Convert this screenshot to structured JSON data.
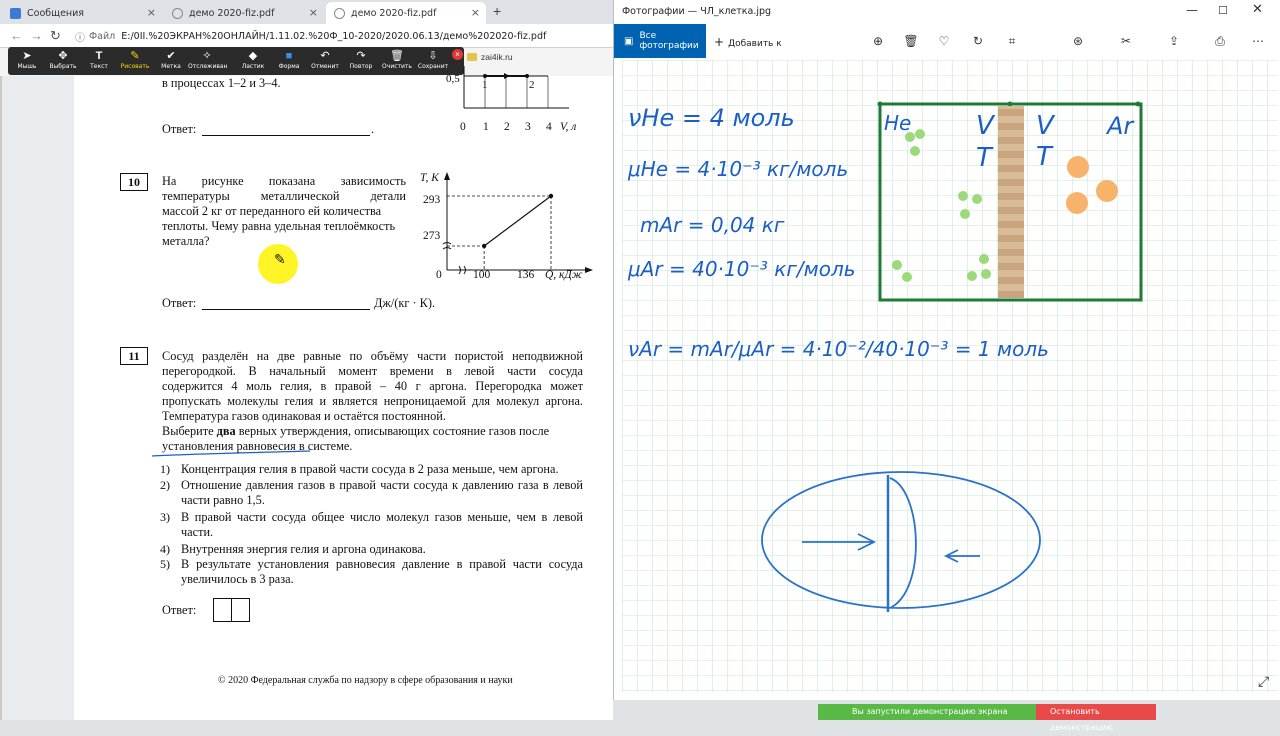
{
  "browser": {
    "tabs": [
      {
        "label": "Сообщения"
      },
      {
        "label": "демо 2020-fiz.pdf"
      },
      {
        "label": "демо 2020-fiz.pdf"
      }
    ],
    "address_proto": "Файл",
    "address_url": "E:/0II.%20ЭКРАН%20ОНЛАЙН/1.11.02.%20Ф_10-2020/2020.06.13/демо%202020-fiz.pdf",
    "bookmark": "zai4ik.ru"
  },
  "annotation_toolbar": {
    "tools": [
      "Мышь",
      "Выбрать",
      "Текст",
      "Рисовать",
      "Метка",
      "Отслеживан",
      "Ластик",
      "Форма",
      "Отменит",
      "Повтор",
      "Очистить",
      "Сохранит"
    ],
    "selected": "Рисовать"
  },
  "pdf": {
    "prev_q_tail": "в процессах 1–2 и 3–4.",
    "answer_label": "Ответ:",
    "answer_period": ".",
    "graph9": {
      "y_tick": "0,5",
      "x_ticks": [
        "0",
        "1",
        "2",
        "3",
        "4"
      ],
      "x_unit": "V, л",
      "points": [
        "1",
        "2"
      ]
    },
    "q10": {
      "number": "10",
      "lines": [
        "На рисунке показана зависимость",
        "температуры металлической детали",
        "массой 2 кг от переданного ей количества",
        "теплоты. Чему равна удельная теплоёмкость",
        "металла?"
      ],
      "answer_unit": "Дж/(кг · К).",
      "graph": {
        "y_label": "T, К",
        "y_ticks": [
          "293",
          "273"
        ],
        "x_ticks": [
          "0",
          "100",
          "136"
        ],
        "x_label": "Q, кДж",
        "data": [
          {
            "q": 100,
            "t": 273
          },
          {
            "q": 136,
            "t": 293
          }
        ]
      }
    },
    "q11": {
      "number": "11",
      "lines": [
        "Сосуд разделён на две равные по объёму части пористой неподвижной",
        "перегородкой. В начальный момент времени в левой части сосуда",
        "содержится 4 моль гелия, в правой – 40 г аргона. Перегородка может",
        "пропускать молекулы гелия и является непроницаемой для молекул аргона.",
        "Температура газов одинаковая и остаётся постоянной."
      ],
      "instr_before": "Выберите ",
      "instr_bold": "два",
      "instr_after": " верных утверждения, описывающих состояние газов после",
      "instr_line2": "установления равновесия в системе.",
      "options": [
        {
          "n": "1)",
          "lines": [
            "Концентрация гелия в правой части сосуда в 2 раза меньше, чем аргона."
          ]
        },
        {
          "n": "2)",
          "lines": [
            "Отношение давления газов в правой части сосуда к давлению газа в левой",
            "части равно 1,5."
          ]
        },
        {
          "n": "3)",
          "lines": [
            "В правой части сосуда общее число молекул газов меньше, чем в левой",
            "части."
          ]
        },
        {
          "n": "4)",
          "lines": [
            "Внутренняя энергия гелия и аргона одинакова."
          ]
        },
        {
          "n": "5)",
          "lines": [
            "В результате установления равновесия давление в правой части сосуда",
            "увеличилось в 3 раза."
          ]
        }
      ]
    },
    "footer": "© 2020 Федеральная служба по надзору в сфере образования и науки"
  },
  "photos": {
    "title": "Фотографии — ЧЛ_клетка.jpg",
    "all_photos": "Все фотографии",
    "add_to": "Добавить к",
    "colors": {
      "accent": "#0063b1",
      "ink": "#1c5fc4",
      "grid": "#b8dcc4",
      "vessel": "#1e7a34",
      "helium": "#9bd97b",
      "argon": "#f7b36b"
    },
    "notes": {
      "he_nu": "νHe = 4 моль",
      "he_mu": "μHe = 4·10⁻³ кг/моль",
      "ar_m": "mAr = 0,04 кг",
      "ar_mu": "μAr = 40·10⁻³ кг/моль",
      "ar_nu": "νAr = mAr/μAr = 4·10⁻²/40·10⁻³ = 1 моль"
    },
    "vessel_labels": {
      "left": "He",
      "right": "Ar",
      "v1": "V",
      "t1": "T",
      "v2": "V",
      "t2": "T"
    }
  },
  "share": {
    "message": "Вы запустили демонстрацию экрана",
    "stop": "Остановить демонстрацию"
  }
}
